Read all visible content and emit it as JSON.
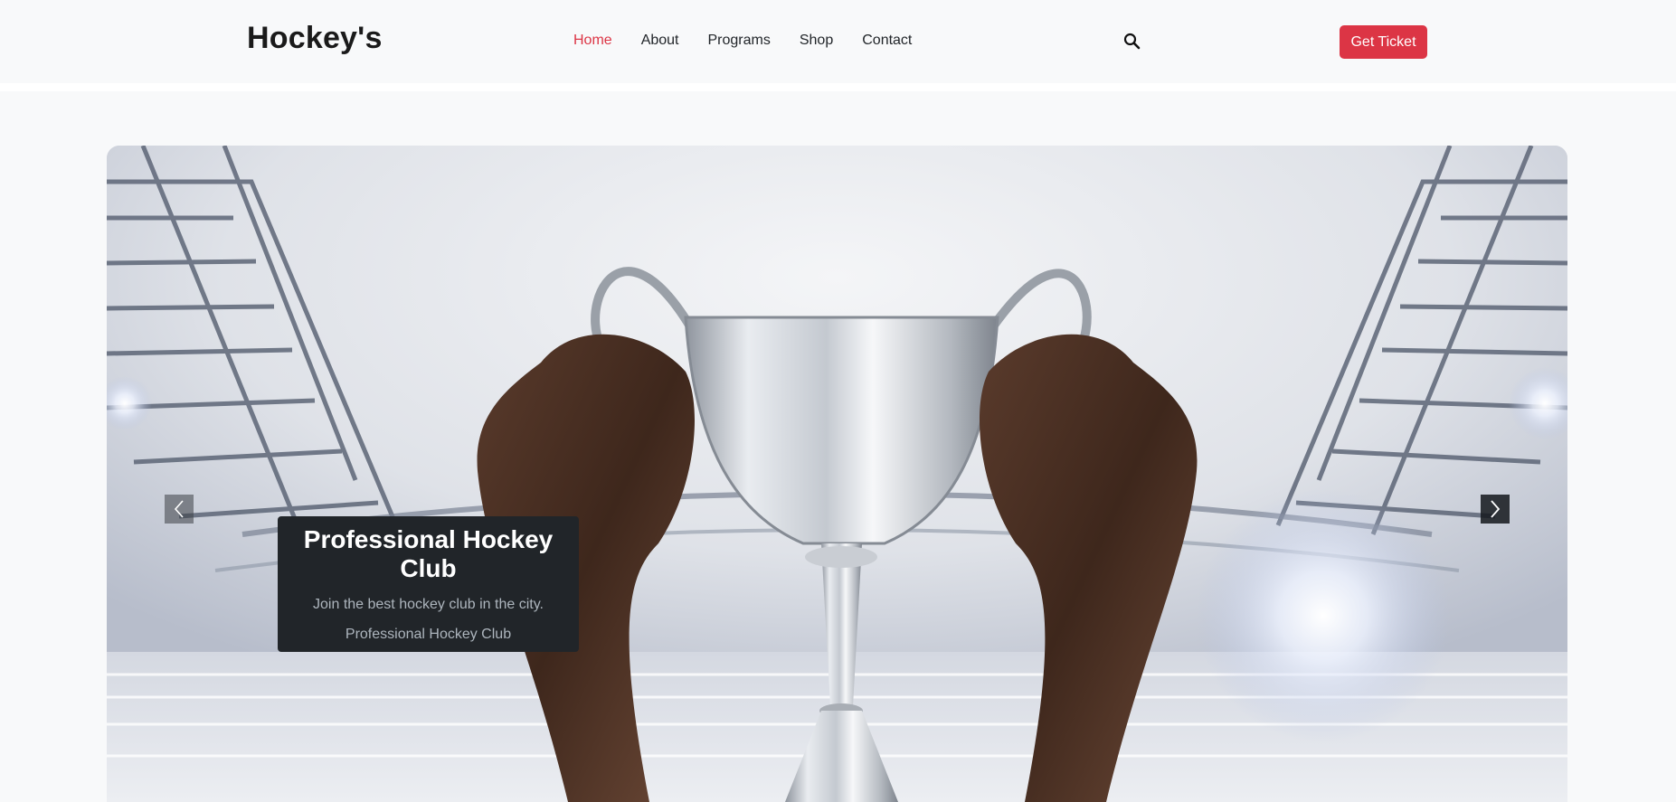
{
  "brand": {
    "name": "Hockey's"
  },
  "nav": {
    "items": [
      {
        "label": "Home",
        "active": true
      },
      {
        "label": "About",
        "active": false
      },
      {
        "label": "Programs",
        "active": false
      },
      {
        "label": "Shop",
        "active": false
      },
      {
        "label": "Contact",
        "active": false
      }
    ],
    "search_icon": "search-icon",
    "cta_label": "Get Ticket"
  },
  "hero": {
    "caption_title": "Professional Hockey Club",
    "caption_text": "Join the best hockey club in the city.",
    "caption_sub": "Professional Hockey Club",
    "prev_icon": "chevron-left-icon",
    "next_icon": "chevron-right-icon"
  },
  "colors": {
    "accent": "#dc3545",
    "nav_bg": "#f8f9fa",
    "caption_bg": "#212529"
  }
}
